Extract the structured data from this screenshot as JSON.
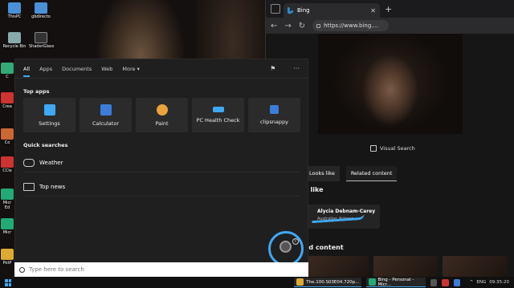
{
  "desktop_icons": [
    {
      "label": "ThisPC",
      "color": "#4a90d9"
    },
    {
      "label": "gbdirecto",
      "color": "#4a90d9"
    },
    {
      "label": "Recycle Bin",
      "color": "#8aa"
    },
    {
      "label": "ShaderGlass",
      "color": "#333"
    },
    {
      "label": "C",
      "color": "#3a7"
    },
    {
      "label": "Crea",
      "color": "#c33"
    },
    {
      "label": "Co",
      "color": "#c63"
    },
    {
      "label": "CCle",
      "color": "#c33"
    },
    {
      "label": "Micr Ed",
      "color": "#2a7"
    },
    {
      "label": "Micr",
      "color": "#2a7"
    },
    {
      "label": "PotP",
      "color": "#da3"
    }
  ],
  "browser": {
    "tab_title": "Bing",
    "new_tab": "+",
    "close": "✕",
    "url": "https://www.bing....",
    "visual_search": "Visual Search",
    "result_tabs": [
      "Looks like",
      "Related content"
    ],
    "looks_like_heading": "s like",
    "card_name": "Alycia Debnam-Carey",
    "card_role": "Australian Actress",
    "related_heading": "ed content"
  },
  "panel": {
    "tabs": [
      "All",
      "Apps",
      "Documents",
      "Web",
      "More ▾"
    ],
    "top_apps_heading": "Top apps",
    "apps": [
      {
        "label": "Settings",
        "color": "#3fa9f5"
      },
      {
        "label": "Calculator",
        "color": "#3b7dd8"
      },
      {
        "label": "Paint",
        "color": "#e8a33d"
      },
      {
        "label": "PC Health Check",
        "color": "#3fa9f5"
      },
      {
        "label": "clipsnappy",
        "color": "#3b7dd8"
      }
    ],
    "quick_searches_heading": "Quick searches",
    "quick_searches": [
      "Weather",
      "Top news"
    ]
  },
  "search": {
    "placeholder": "Type here to search"
  },
  "taskbar": {
    "items": [
      "The.100.S03E04.720p...",
      "Bing - Personal - Micr..."
    ],
    "lang": "ENG",
    "time": "09:35:20"
  }
}
